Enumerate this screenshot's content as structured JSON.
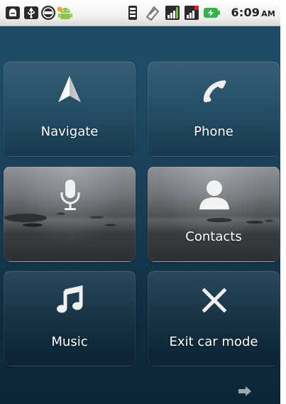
{
  "status_bar": {
    "time": "6:09",
    "ampm": "AM",
    "icons": [
      "usb-debug-icon",
      "usb-icon",
      "voicemail-icon",
      "android-icon",
      "vibrate-icon",
      "sync-icon",
      "signal-icon",
      "signal-roaming-icon",
      "battery-charging-icon"
    ],
    "battery_color": "#33b34a"
  },
  "tiles": {
    "navigate": {
      "label": "Navigate",
      "icon": "navigation-arrow-icon"
    },
    "phone": {
      "label": "Phone",
      "icon": "phone-icon"
    },
    "voice": {
      "icon": "microphone-icon"
    },
    "contacts": {
      "label": "Contacts",
      "icon": "person-icon"
    },
    "music": {
      "label": "Music",
      "icon": "music-note-icon"
    },
    "exit": {
      "label": "Exit car mode",
      "icon": "close-icon"
    }
  },
  "footer": {
    "icon": "right-arrow-icon"
  }
}
